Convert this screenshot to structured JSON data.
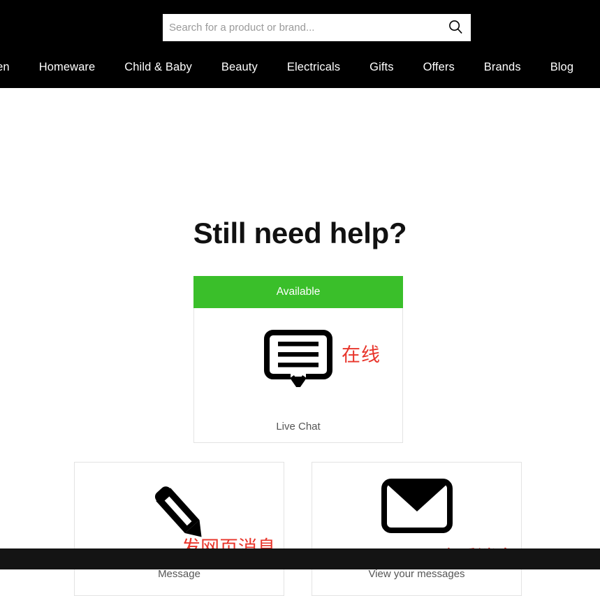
{
  "header": {
    "search": {
      "placeholder": "Search for a product or brand...",
      "value": "",
      "icon": "search-icon"
    },
    "nav_items": [
      {
        "label": "omen"
      },
      {
        "label": "Homeware"
      },
      {
        "label": "Child & Baby"
      },
      {
        "label": "Beauty"
      },
      {
        "label": "Electricals"
      },
      {
        "label": "Gifts"
      },
      {
        "label": "Offers"
      },
      {
        "label": "Brands"
      },
      {
        "label": "Blog"
      }
    ],
    "background_color": "#000000"
  },
  "main": {
    "title": "Still need help?",
    "live_chat": {
      "status_label": "Available",
      "status_color": "#3abf2a",
      "icon": "chat-bubble-icon",
      "label": "Live Chat",
      "annotation": "在线"
    },
    "options": [
      {
        "icon": "pencil-icon",
        "label": "Message",
        "annotation": "发网页消息"
      },
      {
        "icon": "envelope-icon",
        "label": "View your messages",
        "annotation": "查看消息"
      }
    ],
    "annotation_color": "#e8352b"
  },
  "footer": {
    "background_color": "#141414"
  }
}
